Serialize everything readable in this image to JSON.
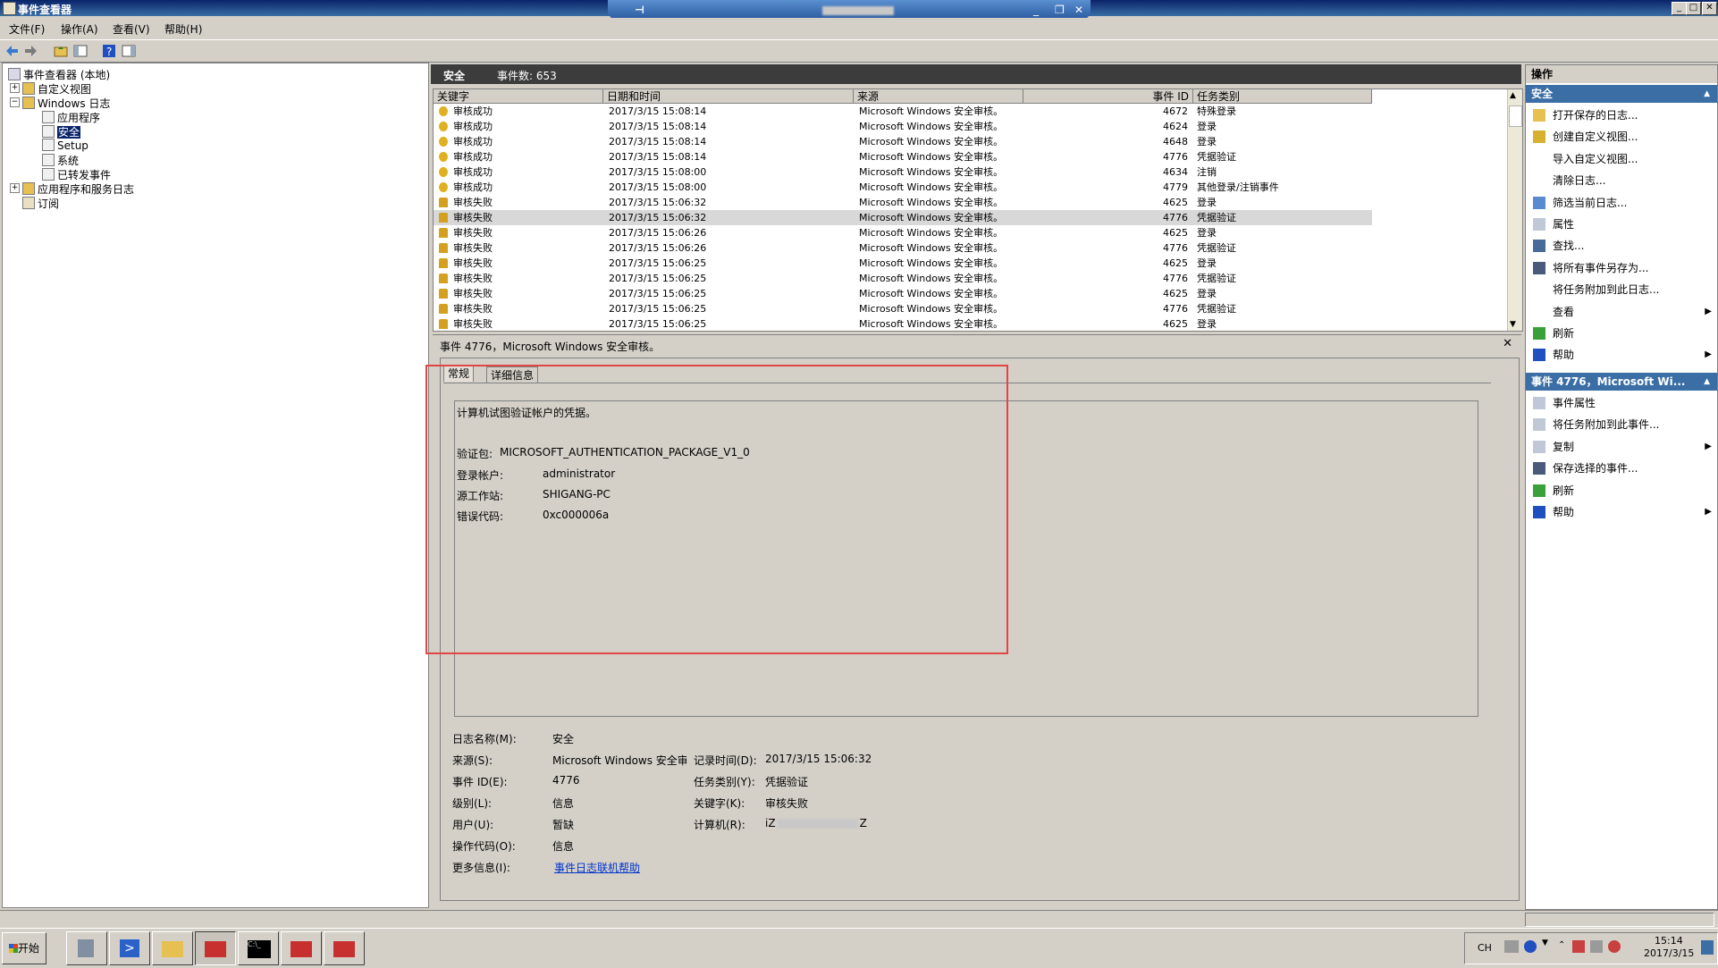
{
  "window": {
    "title": "事件查看器"
  },
  "menu": [
    "文件(F)",
    "操作(A)",
    "查看(V)",
    "帮助(H)"
  ],
  "tree": {
    "root": "事件查看器 (本地)",
    "custom_views": "自定义视图",
    "windows_logs": "Windows 日志",
    "application": "应用程序",
    "security": "安全",
    "setup": "Setup",
    "system": "系统",
    "forwarded": "已转发事件",
    "app_services": "应用程序和服务日志",
    "subscriptions": "订阅"
  },
  "log_header": {
    "name": "安全",
    "count": "事件数: 653"
  },
  "columns": {
    "keyword": "关键字",
    "datetime": "日期和时间",
    "source": "来源",
    "event_id": "事件 ID",
    "category": "任务类别"
  },
  "events": [
    {
      "keyword": "审核成功",
      "datetime": "2017/3/15 15:08:14",
      "source": "Microsoft Windows 安全审核。",
      "event_id": "4672",
      "category": "特殊登录",
      "type": "success",
      "selected": false
    },
    {
      "keyword": "审核成功",
      "datetime": "2017/3/15 15:08:14",
      "source": "Microsoft Windows 安全审核。",
      "event_id": "4624",
      "category": "登录",
      "type": "success",
      "selected": false
    },
    {
      "keyword": "审核成功",
      "datetime": "2017/3/15 15:08:14",
      "source": "Microsoft Windows 安全审核。",
      "event_id": "4648",
      "category": "登录",
      "type": "success",
      "selected": false
    },
    {
      "keyword": "审核成功",
      "datetime": "2017/3/15 15:08:14",
      "source": "Microsoft Windows 安全审核。",
      "event_id": "4776",
      "category": "凭据验证",
      "type": "success",
      "selected": false
    },
    {
      "keyword": "审核成功",
      "datetime": "2017/3/15 15:08:00",
      "source": "Microsoft Windows 安全审核。",
      "event_id": "4634",
      "category": "注销",
      "type": "success",
      "selected": false
    },
    {
      "keyword": "审核成功",
      "datetime": "2017/3/15 15:08:00",
      "source": "Microsoft Windows 安全审核。",
      "event_id": "4779",
      "category": "其他登录/注销事件",
      "type": "success",
      "selected": false
    },
    {
      "keyword": "审核失败",
      "datetime": "2017/3/15 15:06:32",
      "source": "Microsoft Windows 安全审核。",
      "event_id": "4625",
      "category": "登录",
      "type": "fail",
      "selected": false
    },
    {
      "keyword": "审核失败",
      "datetime": "2017/3/15 15:06:32",
      "source": "Microsoft Windows 安全审核。",
      "event_id": "4776",
      "category": "凭据验证",
      "type": "fail",
      "selected": true
    },
    {
      "keyword": "审核失败",
      "datetime": "2017/3/15 15:06:26",
      "source": "Microsoft Windows 安全审核。",
      "event_id": "4625",
      "category": "登录",
      "type": "fail",
      "selected": false
    },
    {
      "keyword": "审核失败",
      "datetime": "2017/3/15 15:06:26",
      "source": "Microsoft Windows 安全审核。",
      "event_id": "4776",
      "category": "凭据验证",
      "type": "fail",
      "selected": false
    },
    {
      "keyword": "审核失败",
      "datetime": "2017/3/15 15:06:25",
      "source": "Microsoft Windows 安全审核。",
      "event_id": "4625",
      "category": "登录",
      "type": "fail",
      "selected": false
    },
    {
      "keyword": "审核失败",
      "datetime": "2017/3/15 15:06:25",
      "source": "Microsoft Windows 安全审核。",
      "event_id": "4776",
      "category": "凭据验证",
      "type": "fail",
      "selected": false
    },
    {
      "keyword": "审核失败",
      "datetime": "2017/3/15 15:06:25",
      "source": "Microsoft Windows 安全审核。",
      "event_id": "4625",
      "category": "登录",
      "type": "fail",
      "selected": false
    },
    {
      "keyword": "审核失败",
      "datetime": "2017/3/15 15:06:25",
      "source": "Microsoft Windows 安全审核。",
      "event_id": "4776",
      "category": "凭据验证",
      "type": "fail",
      "selected": false
    },
    {
      "keyword": "审核失败",
      "datetime": "2017/3/15 15:06:25",
      "source": "Microsoft Windows 安全审核。",
      "event_id": "4625",
      "category": "登录",
      "type": "fail",
      "selected": false
    }
  ],
  "detail": {
    "title": "事件 4776，Microsoft Windows 安全审核。",
    "tabs": [
      "常规",
      "详细信息"
    ],
    "message": "计算机试图验证帐户的凭据。",
    "pkg_label": "验证包:",
    "pkg_value": "MICROSOFT_AUTHENTICATION_PACKAGE_V1_0",
    "account_label": "登录帐户:",
    "account_value": "administrator",
    "workstation_label": "源工作站:",
    "workstation_value": "SHIGANG-PC",
    "error_label": "错误代码:",
    "error_value": "0xc000006a",
    "fields": {
      "log_name_label": "日志名称(M):",
      "log_name": "安全",
      "source_label": "来源(S):",
      "source": "Microsoft Windows 安全审",
      "logged_label": "记录时间(D):",
      "logged": "2017/3/15 15:06:32",
      "event_id_label": "事件 ID(E):",
      "event_id": "4776",
      "task_label": "任务类别(Y):",
      "task": "凭据验证",
      "level_label": "级别(L):",
      "level": "信息",
      "keywords_label": "关键字(K):",
      "keywords": "审核失败",
      "user_label": "用户(U):",
      "user": "暂缺",
      "computer_label": "计算机(R):",
      "computer_prefix": "iZ",
      "computer_suffix": "Z",
      "opcode_label": "操作代码(O):",
      "opcode": "信息",
      "more_label": "更多信息(I):",
      "more_link": "事件日志联机帮助"
    }
  },
  "actions": {
    "header": "操作",
    "section1": "安全",
    "items1": [
      "打开保存的日志...",
      "创建自定义视图...",
      "导入自定义视图...",
      "清除日志...",
      "筛选当前日志...",
      "属性",
      "查找...",
      "将所有事件另存为...",
      "将任务附加到此日志...",
      "查看",
      "刷新",
      "帮助"
    ],
    "section2": "事件 4776，Microsoft Wi...",
    "items2": [
      "事件属性",
      "将任务附加到此事件...",
      "复制",
      "保存选择的事件...",
      "刷新",
      "帮助"
    ]
  },
  "taskbar": {
    "start": "开始",
    "lang": "CH",
    "time": "15:14",
    "date": "2017/3/15"
  },
  "colors": {
    "accent": "#0a246a",
    "annotation": "#e34545",
    "link": "#0033cc"
  }
}
